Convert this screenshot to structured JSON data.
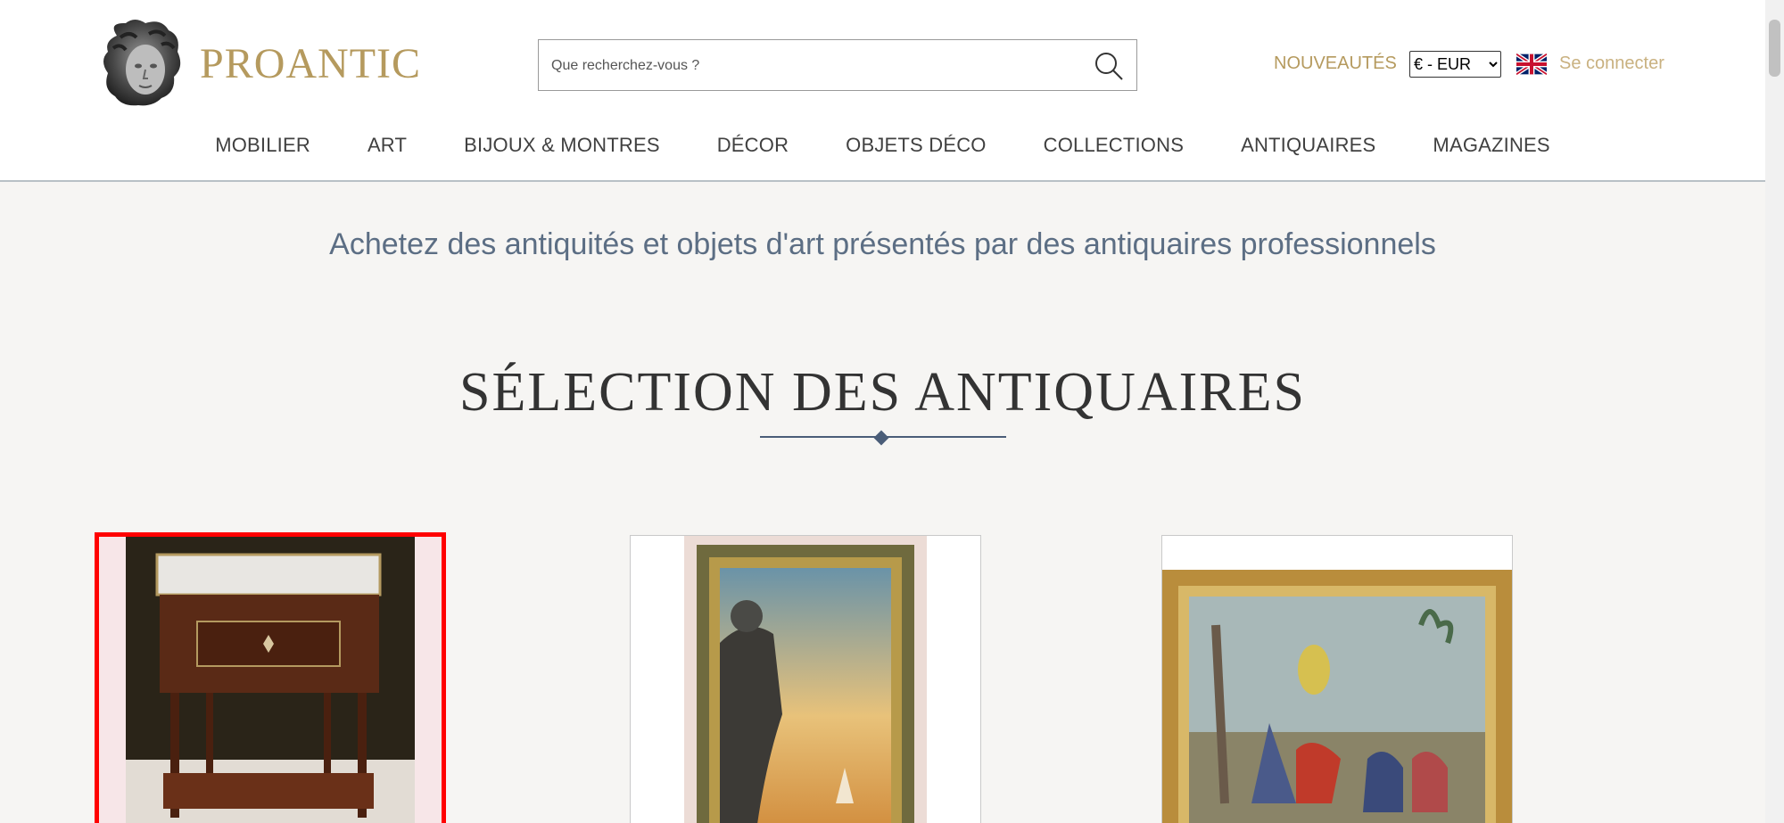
{
  "header": {
    "logo_text": "PROANTIC",
    "search": {
      "placeholder": "Que recherchez-vous ?"
    },
    "new_label": "NOUVEAUTÉS",
    "currency": {
      "selected": "€ - EUR",
      "options": [
        "€ - EUR"
      ]
    },
    "login_label": "Se connecter",
    "flag": "uk-flag-icon"
  },
  "nav": {
    "items": [
      {
        "label": "MOBILIER"
      },
      {
        "label": "ART"
      },
      {
        "label": "BIJOUX & MONTRES"
      },
      {
        "label": "DÉCOR"
      },
      {
        "label": "OBJETS DÉCO"
      },
      {
        "label": "COLLECTIONS"
      },
      {
        "label": "ANTIQUAIRES"
      },
      {
        "label": "MAGAZINES"
      }
    ]
  },
  "main": {
    "tagline": "Achetez des antiquités et objets d'art présentés par des antiquaires professionnels",
    "section_title": "SÉLECTION DES ANTIQUAIRES"
  },
  "colors": {
    "brand_gold": "#b59a5e",
    "tagline_blue": "#5c6e84",
    "selection_red": "#ff0000"
  }
}
